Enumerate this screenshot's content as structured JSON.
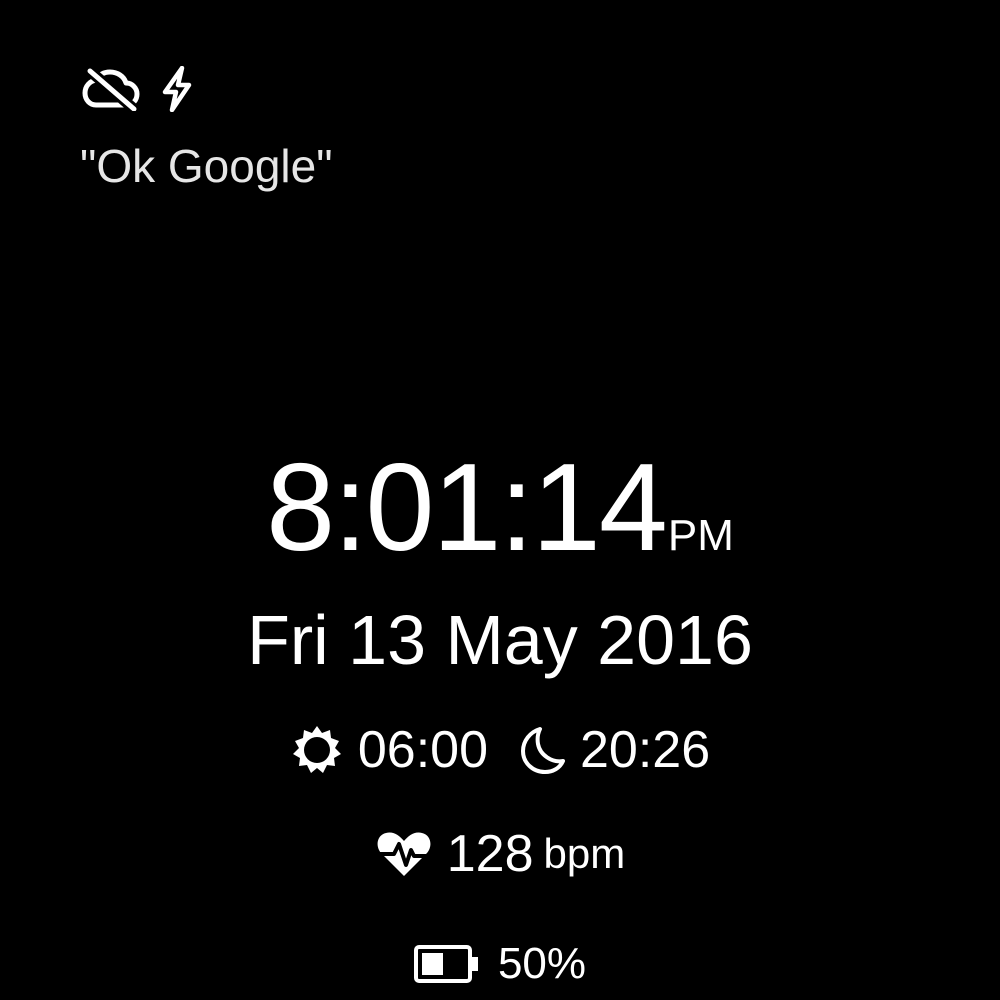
{
  "status_bar": {
    "icons": [
      "cloud-off-icon",
      "charging-bolt-icon"
    ]
  },
  "hotword_hint": "\"Ok Google\"",
  "clock": {
    "time": "8:01:14",
    "ampm": "PM"
  },
  "date": "Fri 13 May 2016",
  "sun": {
    "sunrise": "06:00",
    "sunset": "20:26",
    "sunrise_icon": "sun-icon",
    "sunset_icon": "moon-icon"
  },
  "heart_rate": {
    "value": "128",
    "unit": "bpm",
    "icon": "heart-rate-icon"
  },
  "battery": {
    "level": 0.5,
    "label": "50%",
    "icon": "battery-icon"
  },
  "colors": {
    "background": "#000000",
    "foreground": "#ffffff",
    "hint": "#e6e6e6"
  }
}
